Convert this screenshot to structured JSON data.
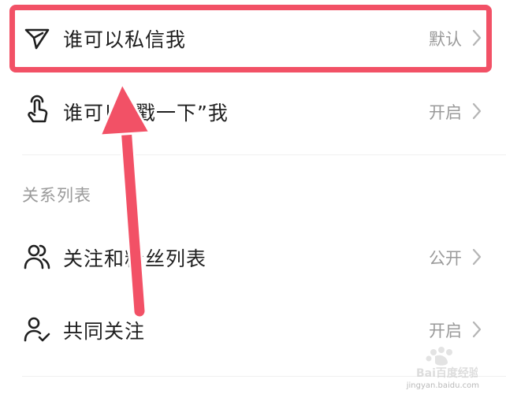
{
  "privacy_rows": [
    {
      "label": "谁可以私信我",
      "value": "默认",
      "icon": "send-icon"
    },
    {
      "label": "谁可以“戳一下”我",
      "value": "开启",
      "icon": "tap-hand-icon"
    }
  ],
  "relations_section": {
    "header": "关系列表",
    "rows": [
      {
        "label": "关注和粉丝列表",
        "value": "公开",
        "icon": "users-icon"
      },
      {
        "label": "共同关注",
        "value": "开启",
        "icon": "user-check-icon"
      }
    ]
  },
  "watermark": {
    "text": "Bai百度经验",
    "url": "jingyan.baidu.com"
  },
  "colors": {
    "highlight": "#f25166",
    "label": "#1f1f1f",
    "secondary": "#9a9a9a"
  }
}
